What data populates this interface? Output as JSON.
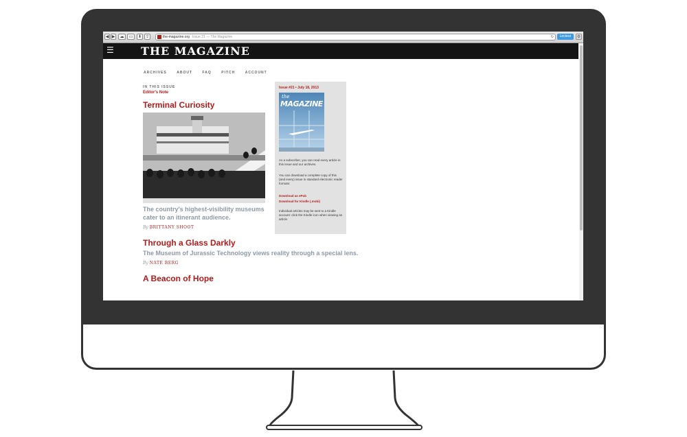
{
  "browser": {
    "url": "the-magazine.org",
    "page_title": "Issue 21 — The Magazine",
    "reader_label": "Lecteur",
    "nav_back": "◀",
    "nav_forward": "▶"
  },
  "site": {
    "logo": "THE MAGAZINE",
    "menu_icon": "☰",
    "nav": [
      "ARCHIVES",
      "ABOUT",
      "FAQ",
      "PITCH",
      "ACCOUNT"
    ]
  },
  "issue": {
    "section_label": "IN THIS ISSUE",
    "editors_note": "Editor's Note",
    "articles": [
      {
        "title": "Terminal Curiosity",
        "subtitle": "The country's highest-visibility museums cater to an itinerant audience.",
        "by": "By",
        "author": "BRITTANY SHOOT"
      },
      {
        "title": "Through a Glass Darkly",
        "subtitle": "The Museum of Jurassic Technology views reality through a special lens.",
        "by": "By",
        "author": "NATE BERG"
      },
      {
        "title": "A Beacon of Hope"
      }
    ]
  },
  "sidebar": {
    "issue_line": "Issue #21 • July 18, 2013",
    "cover_the": "the",
    "cover_title": "MAGAZINE",
    "p1": "As a subscriber, you can read every article in this issue and our archives.",
    "p2": "You can download a complete copy of this (and every) issue in standard electronic reader formats:",
    "download_epub": "Download as ePub",
    "download_kindle": "Download for Kindle (.mobi)",
    "p3": "Individual articles may be sent to a Kindle account: click the Kindle icon when viewing an article."
  },
  "colors": {
    "accent": "#b31b1b",
    "frame": "#333333",
    "masthead": "#141414"
  }
}
